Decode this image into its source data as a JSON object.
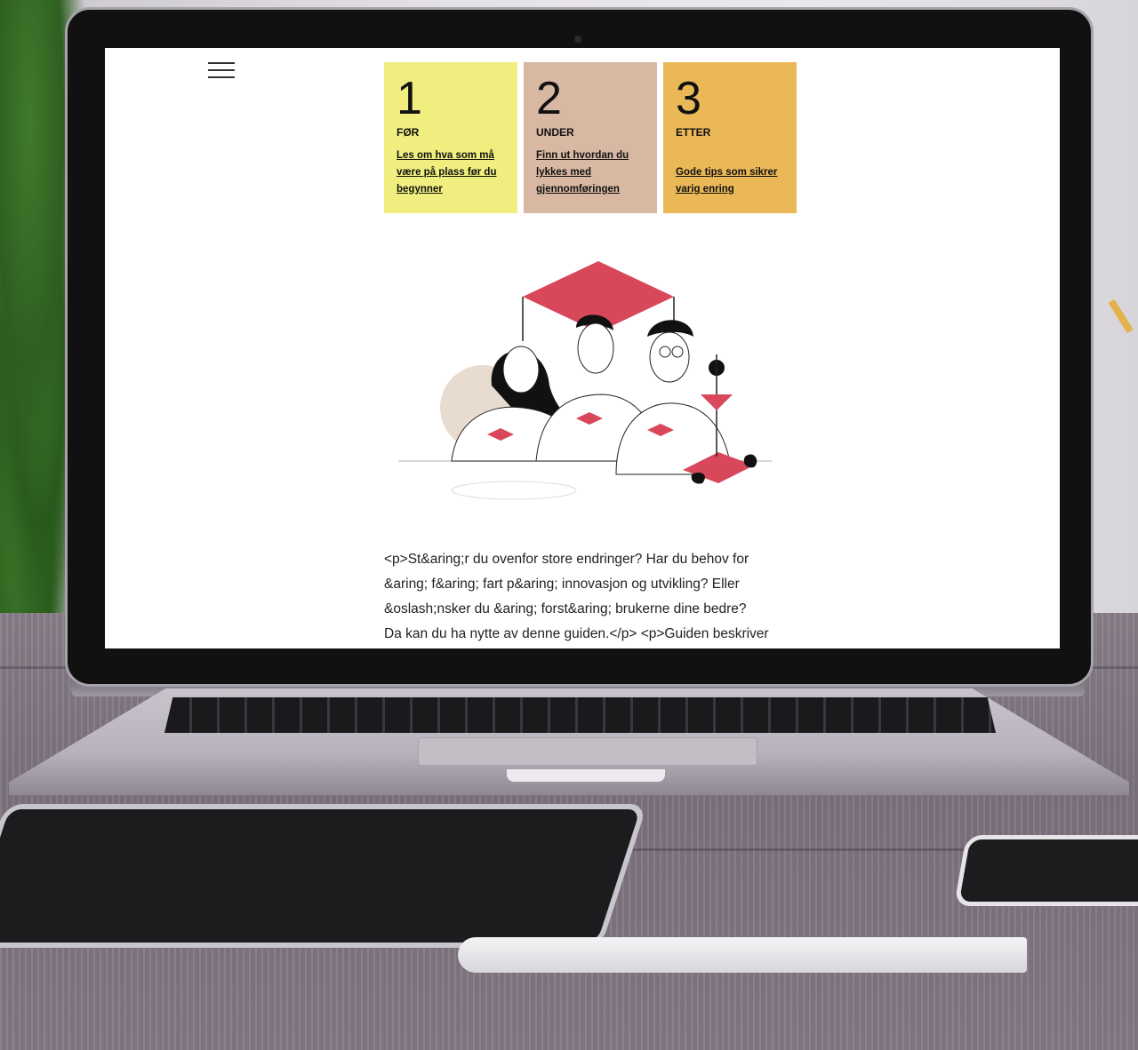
{
  "steps": [
    {
      "number": "1",
      "title": "FØR",
      "link": "Les om hva som må være på plass før du begynner",
      "color": "#f0ee7e"
    },
    {
      "number": "2",
      "title": "UNDER",
      "link": "Finn ut hvordan du lykkes med gjennomføringen",
      "color": "#d8b8a2"
    },
    {
      "number": "3",
      "title": "ETTER",
      "link": "Gode tips som sikrer varig enring",
      "color": "#ebb858"
    }
  ],
  "intro": {
    "lines": [
      "<p>St&aring;r du ovenfor store endringer? Har du behov for",
      "&aring; f&aring; fart p&aring; innovasjon og utvikling? Eller",
      "&oslash;nsker du &aring; forst&aring; brukerne dine bedre?",
      "Da kan du ha nytte av denne guiden.</p> <p>Guiden beskriver"
    ]
  },
  "icons": {
    "menu": "hamburger-menu-icon"
  },
  "colors": {
    "accent": "#d8475a"
  }
}
